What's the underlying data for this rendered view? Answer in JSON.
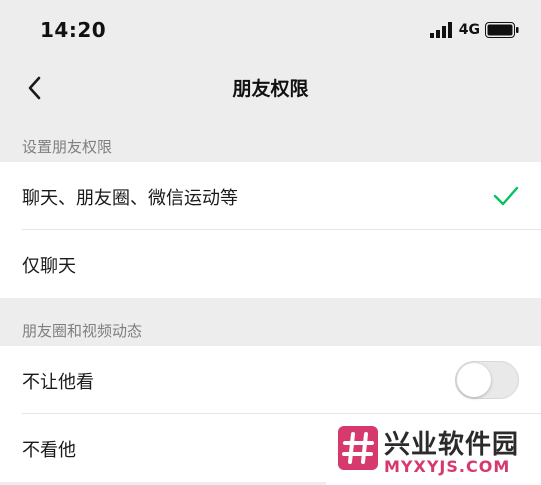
{
  "status_bar": {
    "time": "14:20",
    "network": "4G",
    "signal_icon": "signal-bars-icon",
    "battery_icon": "battery-icon"
  },
  "nav": {
    "back_icon": "chevron-left-icon",
    "title": "朋友权限"
  },
  "sections": [
    {
      "header": "设置朋友权限",
      "items": [
        {
          "label": "聊天、朋友圈、微信运动等",
          "selected": true
        },
        {
          "label": "仅聊天",
          "selected": false
        }
      ]
    },
    {
      "header": "朋友圈和视频动态",
      "items": [
        {
          "label": "不让他看",
          "toggle": false
        },
        {
          "label": "不看他"
        }
      ]
    }
  ],
  "watermark": {
    "logo_icon": "hash-logo-icon",
    "title": "兴业软件园",
    "url": "MYXYJS.COM"
  },
  "colors": {
    "background": "#ededed",
    "row_background": "#ffffff",
    "check": "#07c160",
    "section_text": "#7f7f7f",
    "watermark_accent": "#d6396b"
  }
}
